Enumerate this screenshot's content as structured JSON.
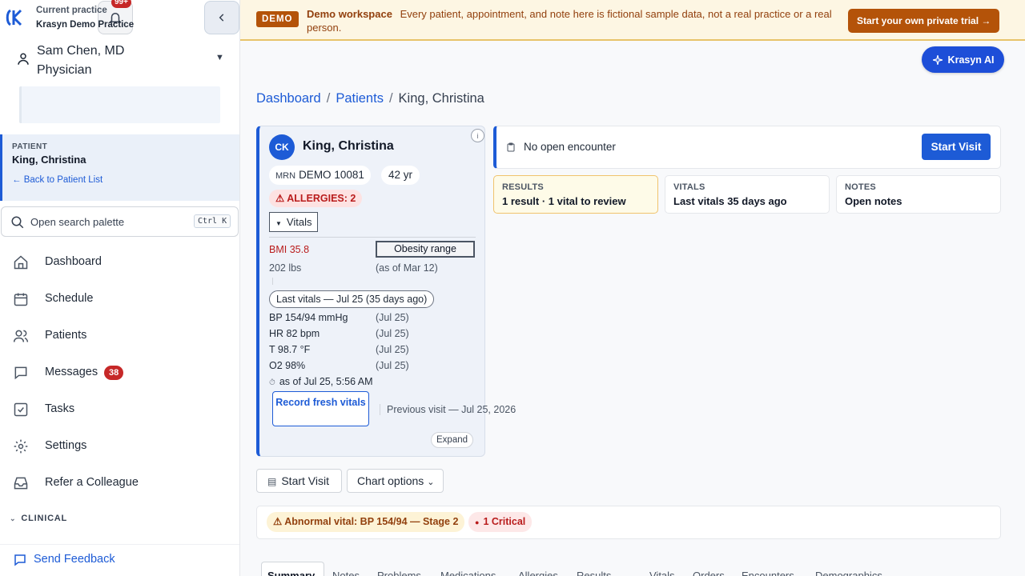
{
  "app": {
    "notifications_badge": "99+",
    "user_name": "Sam Chen, MD",
    "user_role": "Physician",
    "practice_label": "Current practice",
    "practice_name": "Krasyn Demo Practice"
  },
  "sidebar": {
    "patient_label": "PATIENT",
    "patient_name": "King, Christina",
    "back_link": "← Back to Patient List",
    "search_placeholder": "Open search palette",
    "search_shortcut": "Ctrl K",
    "items": [
      {
        "label": "Dashboard",
        "icon": "home-icon"
      },
      {
        "label": "Schedule",
        "icon": "calendar-icon"
      },
      {
        "label": "Patients",
        "icon": "users-icon"
      },
      {
        "label": "Messages",
        "icon": "message-icon",
        "badge": "38"
      },
      {
        "label": "Tasks",
        "icon": "checkbox-icon"
      },
      {
        "label": "Settings",
        "icon": "gear-icon"
      },
      {
        "label": "Refer a Colleague",
        "icon": "inbox-icon"
      }
    ],
    "section_clinical": "CLINICAL",
    "feedback": "Send Feedback"
  },
  "banner": {
    "tag": "DEMO",
    "title": "Demo workspace",
    "text": "Every patient, appointment, and note here is fictional sample data, not a real practice or a real person.",
    "cta": "Start your own private trial →"
  },
  "ai_button": "Krasyn AI",
  "breadcrumb": {
    "items": [
      "Dashboard",
      "Patients",
      "King, Christina"
    ],
    "sep": "/"
  },
  "patient_card": {
    "initials": "CK",
    "name": "King, Christina",
    "info": "i",
    "mrn_label": "MRN",
    "mrn": "DEMO 10081",
    "age": "42 yr",
    "allergies": "ALLERGIES: 2",
    "vitals_toggle": "Vitals",
    "bmi": "BMI 35.8",
    "bmi_range": "Obesity range",
    "weight": "202 lbs",
    "weight_asof": "(as of Mar 12)",
    "last_vitals": "Last vitals — Jul 25 (35 days ago)",
    "vitals": [
      {
        "label": "BP 154/94 mmHg",
        "date": "(Jul 25)"
      },
      {
        "label": "HR 82 bpm",
        "date": "(Jul 25)"
      },
      {
        "label": "T 98.7 °F",
        "date": "(Jul 25)"
      },
      {
        "label": "O2 98%",
        "date": "(Jul 25)"
      }
    ],
    "vitals_asof": "as of Jul 25, 5:56 AM",
    "record_btn": "Record fresh vitals",
    "previous_visit": "Previous visit — Jul 25, 2026",
    "expand": "Expand"
  },
  "encounter": {
    "text": "No open encounter",
    "button": "Start Visit"
  },
  "summary_cards": [
    {
      "label": "RESULTS",
      "value": "1 result · 1 vital to review"
    },
    {
      "label": "VITALS",
      "value": "Last vitals 35 days ago"
    },
    {
      "label": "NOTES",
      "value": "Open notes"
    }
  ],
  "actions": {
    "start_visit": "Start Visit",
    "chart_options": "Chart options"
  },
  "alerts": {
    "abnormal": "Abnormal vital: BP 154/94 — Stage 2",
    "critical": "1 Critical"
  },
  "tabs": [
    "Summary",
    "Notes",
    "Problems",
    "Medications",
    "Allergies",
    "Results",
    "Vitals",
    "Orders",
    "Encounters",
    "Demographics"
  ],
  "colors": {
    "accent": "#1d5bd6",
    "danger": "#c62828",
    "banner_bg": "#fdf6e3",
    "banner_btn": "#b45309"
  }
}
